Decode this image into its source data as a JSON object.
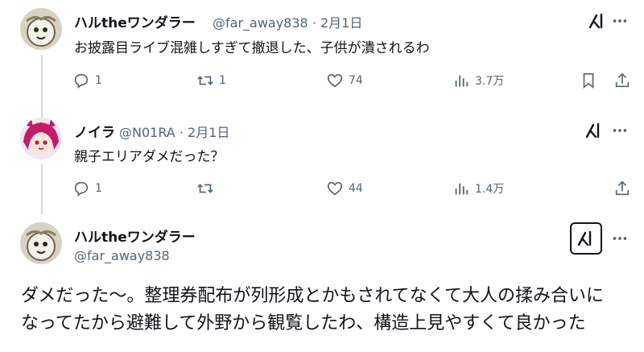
{
  "tweets": [
    {
      "display_name": "ハルtheワンダラー",
      "handle": "@far_away838",
      "separator": "·",
      "date": "2月1日",
      "text": "お披露目ライブ混雑しすぎて撤退した、子供が潰されるわ",
      "reply_count": "1",
      "retweet_count": "1",
      "like_count": "74",
      "view_count": "3.7万"
    },
    {
      "display_name": "ノイラ",
      "handle": "@N01RA",
      "separator": "·",
      "date": "2月1日",
      "text": "親子エリアダメだった？",
      "reply_count": "1",
      "like_count": "44",
      "view_count": "1.4万"
    }
  ],
  "main_tweet": {
    "display_name": "ハルtheワンダラー",
    "handle": "@far_away838",
    "text_line1": "ダメだった〜。整理券配布が列形成とかもされてなくて大人の揉み合いに",
    "text_line2": "なってたから避難して外野から観覧したわ、構造上見やすくて良かった"
  }
}
